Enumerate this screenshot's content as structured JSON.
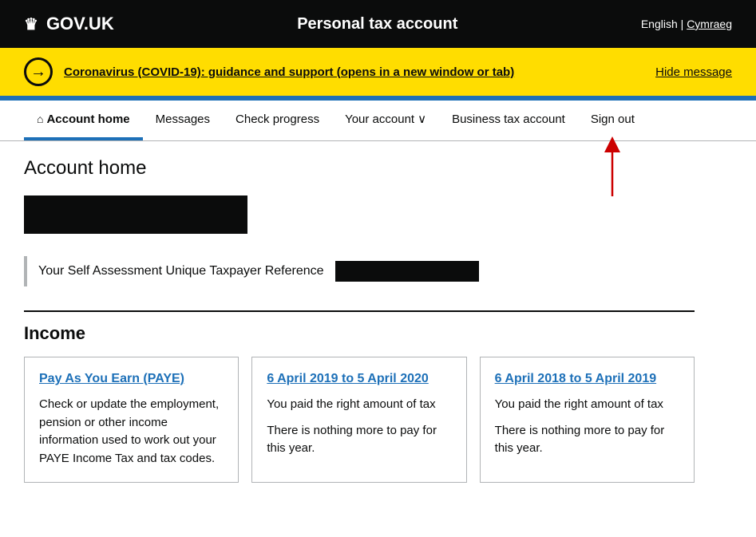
{
  "header": {
    "logo_text": "GOV.UK",
    "crown_symbol": "♛",
    "title": "Personal tax account",
    "lang_english": "English",
    "lang_separator": "|",
    "lang_welsh": "Cymraeg"
  },
  "covid_banner": {
    "arrow_symbol": "→",
    "link_text": "Coronavirus (COVID-19): guidance and support (opens in a new window or tab)",
    "hide_label": "Hide message"
  },
  "nav": {
    "items": [
      {
        "label": "Account home",
        "icon": "⌂",
        "active": true
      },
      {
        "label": "Messages",
        "active": false
      },
      {
        "label": "Check progress",
        "active": false
      },
      {
        "label": "Your account",
        "dropdown": true,
        "active": false
      },
      {
        "label": "Business tax account",
        "active": false
      },
      {
        "label": "Sign out",
        "active": false
      }
    ]
  },
  "page": {
    "heading": "Account home",
    "utr_label": "Your Self Assessment Unique Taxpayer Reference"
  },
  "income": {
    "section_title": "Income",
    "cards": [
      {
        "title": "Pay As You Earn (PAYE)",
        "body_lines": [
          "Check or update the employment, pension or other income information used to work out your PAYE Income Tax and tax codes."
        ]
      },
      {
        "title": "6 April 2019 to 5 April 2020",
        "body_lines": [
          "You paid the right amount of tax",
          "There is nothing more to pay for this year."
        ]
      },
      {
        "title": "6 April 2018 to 5 April 2019",
        "body_lines": [
          "You paid the right amount of tax",
          "There is nothing more to pay for this year."
        ]
      }
    ]
  }
}
